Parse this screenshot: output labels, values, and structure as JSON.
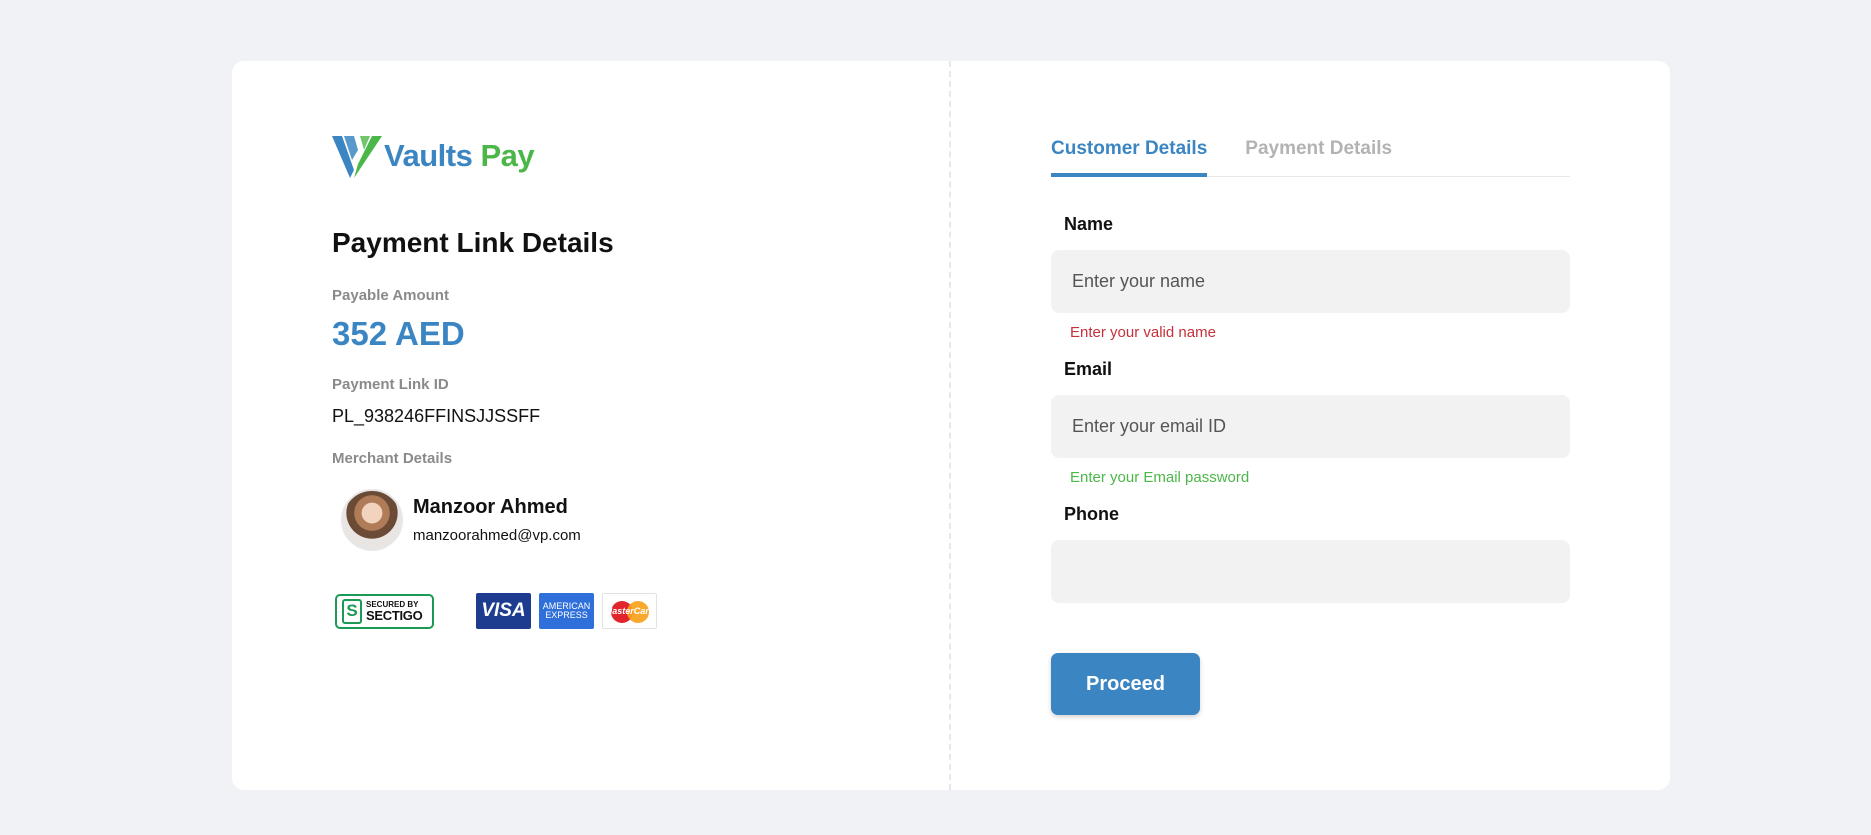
{
  "brand": {
    "name_part1": "Vaults",
    "name_part2": "Pay",
    "primary_color": "#3b86c2",
    "secondary_color": "#4cb749"
  },
  "payment": {
    "title": "Payment Link Details",
    "payable_amount_label": "Payable Amount",
    "payable_amount": "352 AED",
    "link_id_label": "Payment Link ID",
    "link_id": "PL_938246FFINSJJSSFF",
    "merchant_label": "Merchant Details",
    "merchant": {
      "name": "Manzoor Ahmed",
      "email": "manzoorahmed@vp.com"
    }
  },
  "badges": {
    "sectigo_small": "SECURED BY",
    "sectigo_big": "SECTIGO",
    "sectigo_icon": "S",
    "visa": "VISA",
    "amex_line1": "AMERICAN",
    "amex_line2": "EXPRESS",
    "mastercard": "MasterCard"
  },
  "tabs": [
    {
      "label": "Customer Details",
      "active": true
    },
    {
      "label": "Payment Details",
      "active": false
    }
  ],
  "form": {
    "name_label": "Name",
    "name_placeholder": "Enter your name",
    "name_hint": "Enter your valid name",
    "email_label": "Email",
    "email_placeholder": "Enter your email ID",
    "email_hint": "Enter your Email password",
    "phone_label": "Phone",
    "phone_placeholder": "",
    "proceed_label": "Proceed"
  },
  "colors": {
    "background": "#f0f2f5",
    "error": "#c5303a",
    "success": "#4cb749"
  }
}
